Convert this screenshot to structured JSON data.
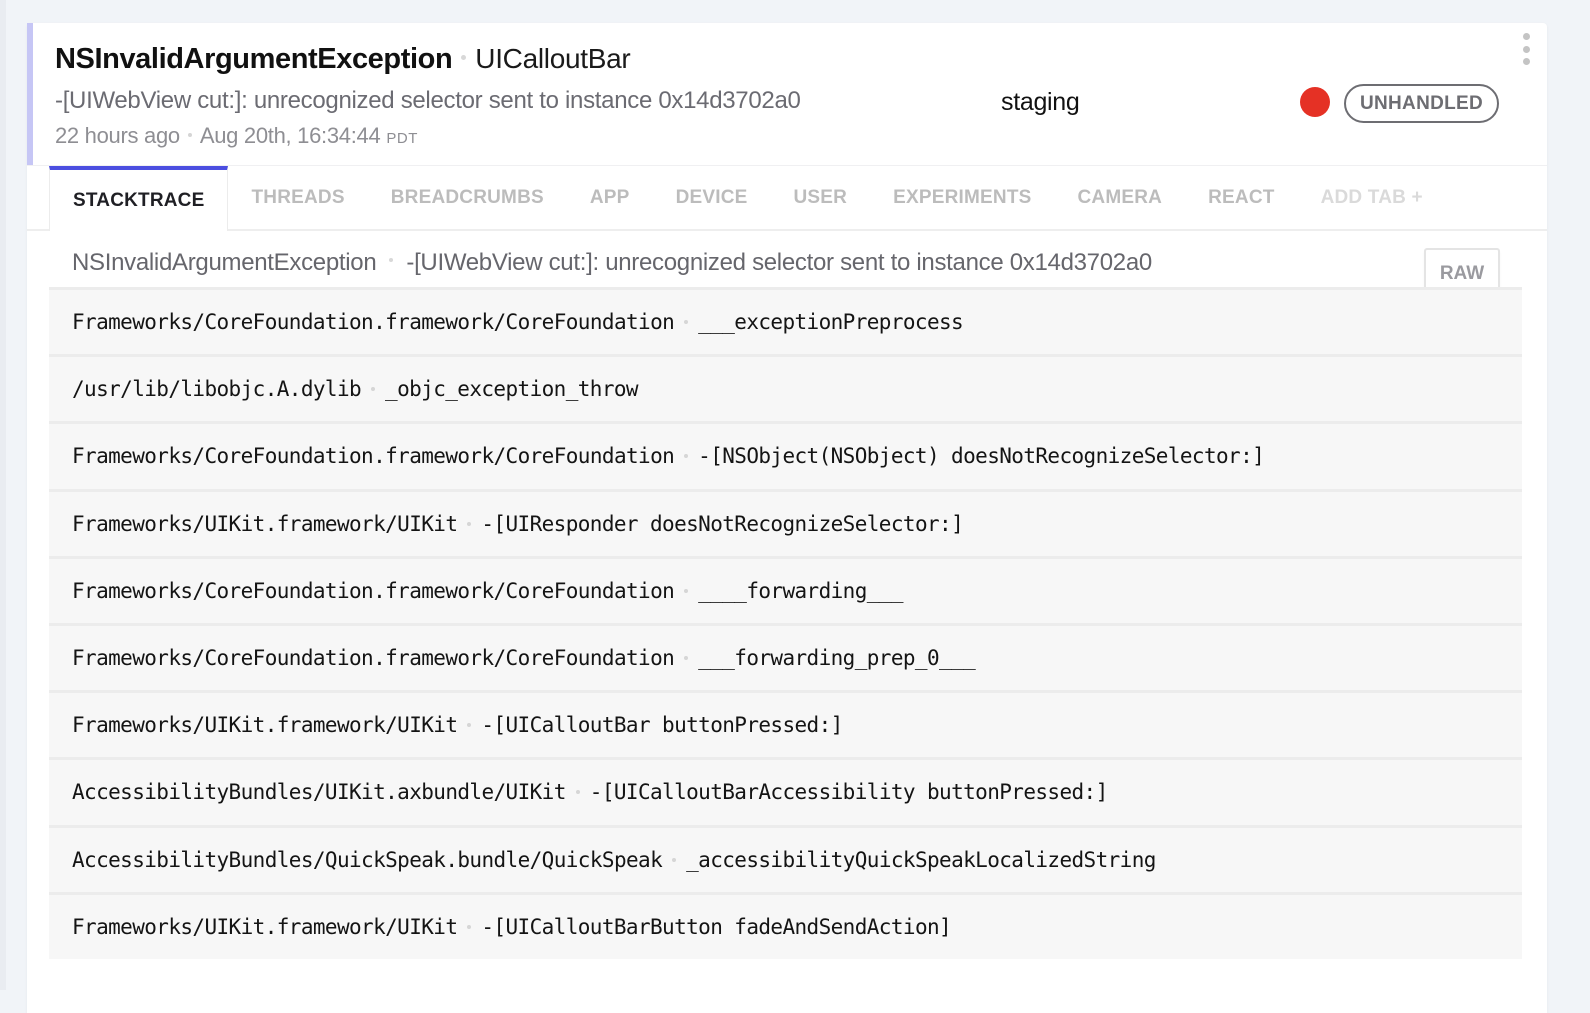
{
  "error": {
    "class": "NSInvalidArgumentException",
    "context": "UICalloutBar",
    "message": "-[UIWebView cut:]: unrecognized selector sent to instance 0x14d3702a0",
    "relative_time": "22 hours ago",
    "timestamp": "Aug 20th, 16:34:44",
    "timezone": "PDT",
    "release_stage": "staging",
    "severity_color": "#e53125",
    "severity": "error",
    "handled_badge": "UNHANDLED",
    "menu_icon": "more-vertical-icon"
  },
  "tabs": [
    {
      "label": "STACKTRACE",
      "active": true
    },
    {
      "label": "THREADS",
      "active": false
    },
    {
      "label": "BREADCRUMBS",
      "active": false
    },
    {
      "label": "APP",
      "active": false
    },
    {
      "label": "DEVICE",
      "active": false
    },
    {
      "label": "USER",
      "active": false
    },
    {
      "label": "EXPERIMENTS",
      "active": false
    },
    {
      "label": "CAMERA",
      "active": false
    },
    {
      "label": "REACT",
      "active": false
    },
    {
      "label": "ADD TAB +",
      "active": false
    }
  ],
  "stacktrace": {
    "exception_class": "NSInvalidArgumentException",
    "exception_message": "-[UIWebView cut:]: unrecognized selector sent to instance 0x14d3702a0",
    "raw_button": "RAW",
    "frames": [
      {
        "file": "Frameworks/CoreFoundation.framework/CoreFoundation",
        "method": "___exceptionPreprocess"
      },
      {
        "file": "/usr/lib/libobjc.A.dylib",
        "method": "_objc_exception_throw"
      },
      {
        "file": "Frameworks/CoreFoundation.framework/CoreFoundation",
        "method": "-[NSObject(NSObject) doesNotRecognizeSelector:]"
      },
      {
        "file": "Frameworks/UIKit.framework/UIKit",
        "method": "-[UIResponder doesNotRecognizeSelector:]"
      },
      {
        "file": "Frameworks/CoreFoundation.framework/CoreFoundation",
        "method": "____forwarding___"
      },
      {
        "file": "Frameworks/CoreFoundation.framework/CoreFoundation",
        "method": "___forwarding_prep_0___"
      },
      {
        "file": "Frameworks/UIKit.framework/UIKit",
        "method": "-[UICalloutBar buttonPressed:]"
      },
      {
        "file": "AccessibilityBundles/UIKit.axbundle/UIKit",
        "method": "-[UICalloutBarAccessibility buttonPressed:]"
      },
      {
        "file": "AccessibilityBundles/QuickSpeak.bundle/QuickSpeak",
        "method": "_accessibilityQuickSpeakLocalizedString"
      },
      {
        "file": "Frameworks/UIKit.framework/UIKit",
        "method": "-[UICalloutBarButton fadeAndSendAction]"
      }
    ]
  }
}
